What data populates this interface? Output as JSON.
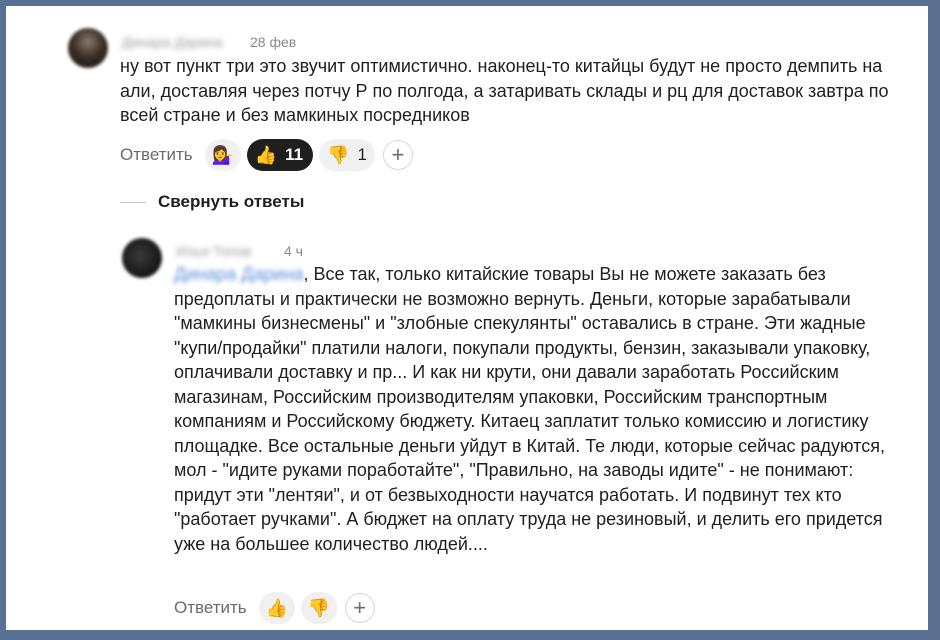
{
  "comments": [
    {
      "author": "Динара Дарина",
      "time": "28 фев",
      "text": "ну вот пункт три это звучит оптимистично. наконец-то китайцы будут не просто демпить на али, доставляя через потчу Р по полгода, а затаривать склады и рц для доставок завтра по всей стране и без мамкиных посредников",
      "reply_label": "Ответить",
      "reactions": {
        "custom_emoji": "💁‍♀️",
        "like_emoji": "👍",
        "like_count": "11",
        "dislike_emoji": "👎",
        "dislike_count": "1",
        "add_label": "+"
      }
    },
    {
      "author": "Илья Топов",
      "time": "4 ч",
      "mention": "Динара Дарина",
      "text": ", Все так, только китайские товары Вы не можете заказать без предоплаты и практически не возможно вернуть. Деньги, которые зарабатывали \"мамкины бизнесмены\" и \"злобные спекулянты\" оставались в стране. Эти жадные \"купи/продайки\" платили налоги, покупали продукты, бензин, заказывали упаковку, оплачивали доставку и пр... И как ни крути, они давали заработать Российским магазинам, Российским производителям упаковки, Российским транспортным компаниям и Российскому бюджету. Китаец заплатит только комиссию и логистику площадке. Все остальные деньги уйдут в Китай. Те люди, которые сейчас радуются, мол - \"идите руками поработайте\", \"Правильно, на заводы идите\" - не понимают: придут эти \"лентяи\", и от безвыходности научатся работать. И подвинут тех кто \"работает ручками\". А бюджет на оплату труда не резиновый, и делить его придется уже на большее количество людей....",
      "reply_label": "Ответить",
      "reactions": {
        "like_emoji": "👍",
        "dislike_emoji": "👎",
        "add_label": "+"
      }
    }
  ],
  "collapse_label": "Свернуть ответы",
  "colors": {
    "background": "#5a7194",
    "card": "#ffffff",
    "pill": "#f0f0f0",
    "pill_active": "#1f1f1f",
    "mention": "#5b8fd9"
  }
}
